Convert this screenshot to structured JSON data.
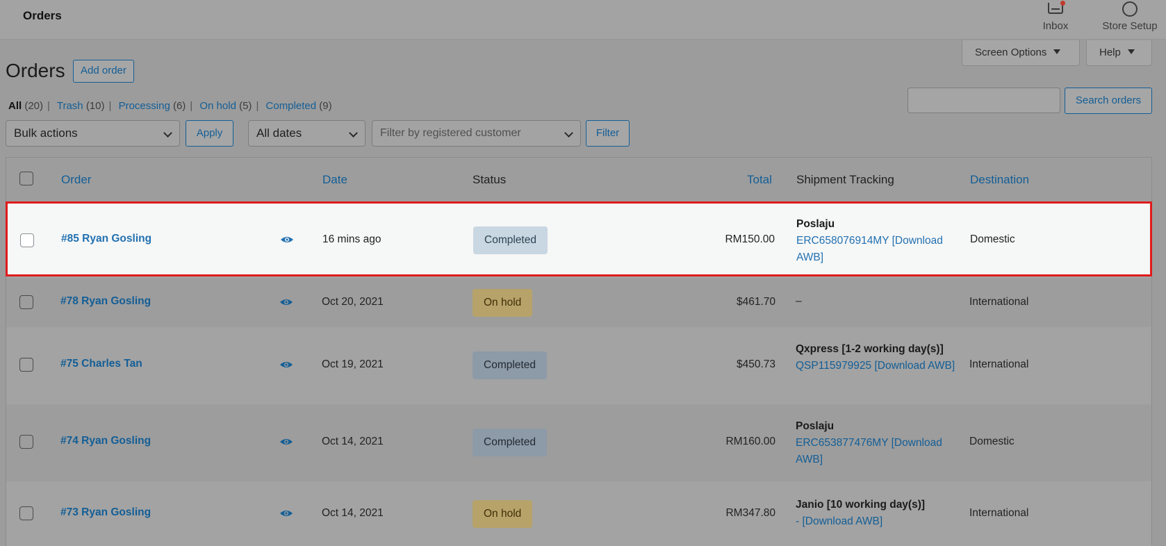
{
  "topbar": {
    "title": "Orders",
    "inbox_label": "Inbox",
    "store_setup_label": "Store Setup"
  },
  "screen_options_label": "Screen Options",
  "help_label": "Help",
  "page_title": "Orders",
  "add_order_label": "Add order",
  "views": [
    {
      "label": "All",
      "count": "(20)"
    },
    {
      "label": "Trash",
      "count": "(10)"
    },
    {
      "label": "Processing",
      "count": "(6)"
    },
    {
      "label": "On hold",
      "count": "(5)"
    },
    {
      "label": "Completed",
      "count": "(9)"
    }
  ],
  "search": {
    "value": "",
    "button_label": "Search orders"
  },
  "filters": {
    "bulk_actions": "Bulk actions",
    "apply_label": "Apply",
    "dates": "All dates",
    "customer_placeholder": "Filter by registered customer",
    "filter_label": "Filter"
  },
  "columns": {
    "order": "Order",
    "date": "Date",
    "status": "Status",
    "total": "Total",
    "shipment": "Shipment Tracking",
    "destination": "Destination"
  },
  "orders": [
    {
      "order": "#85 Ryan Gosling",
      "date": "16 mins ago",
      "status": "Completed",
      "total": "RM150.00",
      "carrier": "Poslaju",
      "tracking": "ERC658076914MY [Download AWB]",
      "destination": "Domestic"
    },
    {
      "order": "#78 Ryan Gosling",
      "date": "Oct 20, 2021",
      "status": "On hold",
      "total": "$461.70",
      "carrier": "",
      "tracking": "–",
      "destination": "International"
    },
    {
      "order": "#75 Charles Tan",
      "date": "Oct 19, 2021",
      "status": "Completed",
      "total": "$450.73",
      "carrier": "Qxpress [1-2 working day(s)]",
      "tracking": "QSP115979925 [Download AWB]",
      "destination": "International"
    },
    {
      "order": "#74 Ryan Gosling",
      "date": "Oct 14, 2021",
      "status": "Completed",
      "total": "RM160.00",
      "carrier": "Poslaju",
      "tracking": "ERC653877476MY [Download AWB]",
      "destination": "Domestic"
    },
    {
      "order": "#73 Ryan Gosling",
      "date": "Oct 14, 2021",
      "status": "On hold",
      "total": "RM347.80",
      "carrier": "Janio [10 working day(s)]",
      "tracking": "- [Download AWB]",
      "destination": "International"
    }
  ],
  "colors": {
    "link": "#135e96",
    "highlight_border": "#e01b1b",
    "overlay": "#9c9c9c"
  }
}
